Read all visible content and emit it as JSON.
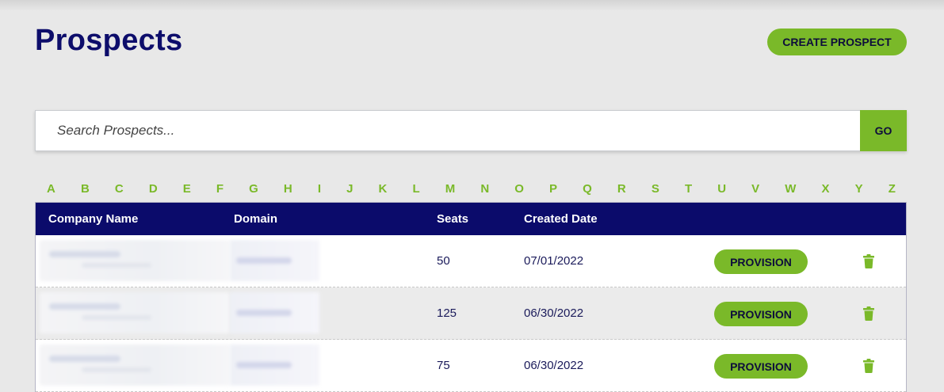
{
  "header": {
    "title": "Prospects",
    "create_label": "CREATE PROSPECT"
  },
  "search": {
    "placeholder": "Search Prospects...",
    "value": "",
    "go_label": "GO"
  },
  "alphabet": [
    "A",
    "B",
    "C",
    "D",
    "E",
    "F",
    "G",
    "H",
    "I",
    "J",
    "K",
    "L",
    "M",
    "N",
    "O",
    "P",
    "Q",
    "R",
    "S",
    "T",
    "U",
    "V",
    "W",
    "X",
    "Y",
    "Z"
  ],
  "table": {
    "columns": [
      "Company Name",
      "Domain",
      "Seats",
      "Created Date"
    ],
    "rows": [
      {
        "seats": "50",
        "created": "07/01/2022",
        "action": "PROVISION"
      },
      {
        "seats": "125",
        "created": "06/30/2022",
        "action": "PROVISION"
      },
      {
        "seats": "75",
        "created": "06/30/2022",
        "action": "PROVISION"
      }
    ]
  },
  "icons": {
    "delete": "trash-icon"
  },
  "colors": {
    "accent_green": "#7ab929",
    "navy": "#0b0b6b",
    "background": "#e8e8e8"
  }
}
